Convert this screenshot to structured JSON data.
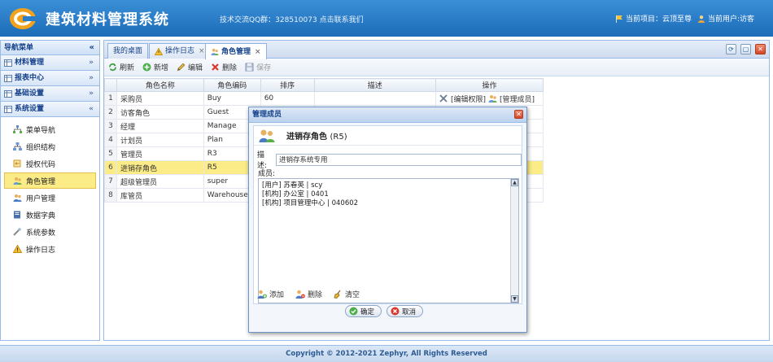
{
  "header": {
    "app_title": "建筑材料管理系统",
    "qq_text": "技术交流QQ群：328510073 点击联系我们",
    "current_project": "当前项目：云顶至尊",
    "current_user": "当前用户:访客"
  },
  "nav": {
    "title": "导航菜单",
    "groups": [
      {
        "label": "材料管理"
      },
      {
        "label": "报表中心"
      },
      {
        "label": "基础设置"
      },
      {
        "label": "系统设置"
      }
    ],
    "items": [
      {
        "label": "菜单导航",
        "icon": "menu-tree-icon"
      },
      {
        "label": "组织结构",
        "icon": "org-icon"
      },
      {
        "label": "授权代码",
        "icon": "key-icon"
      },
      {
        "label": "角色管理",
        "icon": "role-icon",
        "active": true
      },
      {
        "label": "用户管理",
        "icon": "users-icon"
      },
      {
        "label": "数据字典",
        "icon": "book-icon"
      },
      {
        "label": "系统参数",
        "icon": "params-icon"
      },
      {
        "label": "操作日志",
        "icon": "warning-icon"
      }
    ]
  },
  "tabs": [
    {
      "label": "我的桌面"
    },
    {
      "label": "操作日志"
    },
    {
      "label": "角色管理"
    }
  ],
  "toolbar": {
    "refresh": "刷新",
    "add": "新增",
    "edit": "编辑",
    "delete": "删除",
    "save": "保存"
  },
  "grid": {
    "columns": [
      "角色名称",
      "角色编码",
      "排序",
      "描述",
      "操作"
    ],
    "rows": [
      {
        "num": "1",
        "name": "采购员",
        "code": "Buy",
        "sort": "60"
      },
      {
        "num": "2",
        "name": "访客角色",
        "code": "Guest",
        "sort": ""
      },
      {
        "num": "3",
        "name": "经理",
        "code": "Manage",
        "sort": ""
      },
      {
        "num": "4",
        "name": "计划员",
        "code": "Plan",
        "sort": ""
      },
      {
        "num": "5",
        "name": "管理员",
        "code": "R3",
        "sort": ""
      },
      {
        "num": "6",
        "name": "进销存角色",
        "code": "R5",
        "sort": "",
        "selected": true
      },
      {
        "num": "7",
        "name": "超级管理员",
        "code": "super",
        "sort": ""
      },
      {
        "num": "8",
        "name": "库管员",
        "code": "Warehouse",
        "sort": ""
      }
    ],
    "op_edit_perm": "[编辑权限]",
    "op_manage_members": "[管理成员]"
  },
  "modal": {
    "title": "管理成员",
    "role_name": "进销存角色",
    "role_code": "(R5)",
    "desc_label": "描述:",
    "desc_value": "进销存系统专用",
    "members_label": "成员:",
    "members": [
      "[用户] 苏春英 | scy",
      "[机构] 办公室 | 0401",
      "[机构] 项目管理中心 | 040602"
    ],
    "add": "添加",
    "delete": "删除",
    "clear": "清空",
    "ok": "确定",
    "cancel": "取消"
  },
  "footer": {
    "copyright": "Copyright © 2012-2021 Zephyr, All Rights Reserved"
  }
}
